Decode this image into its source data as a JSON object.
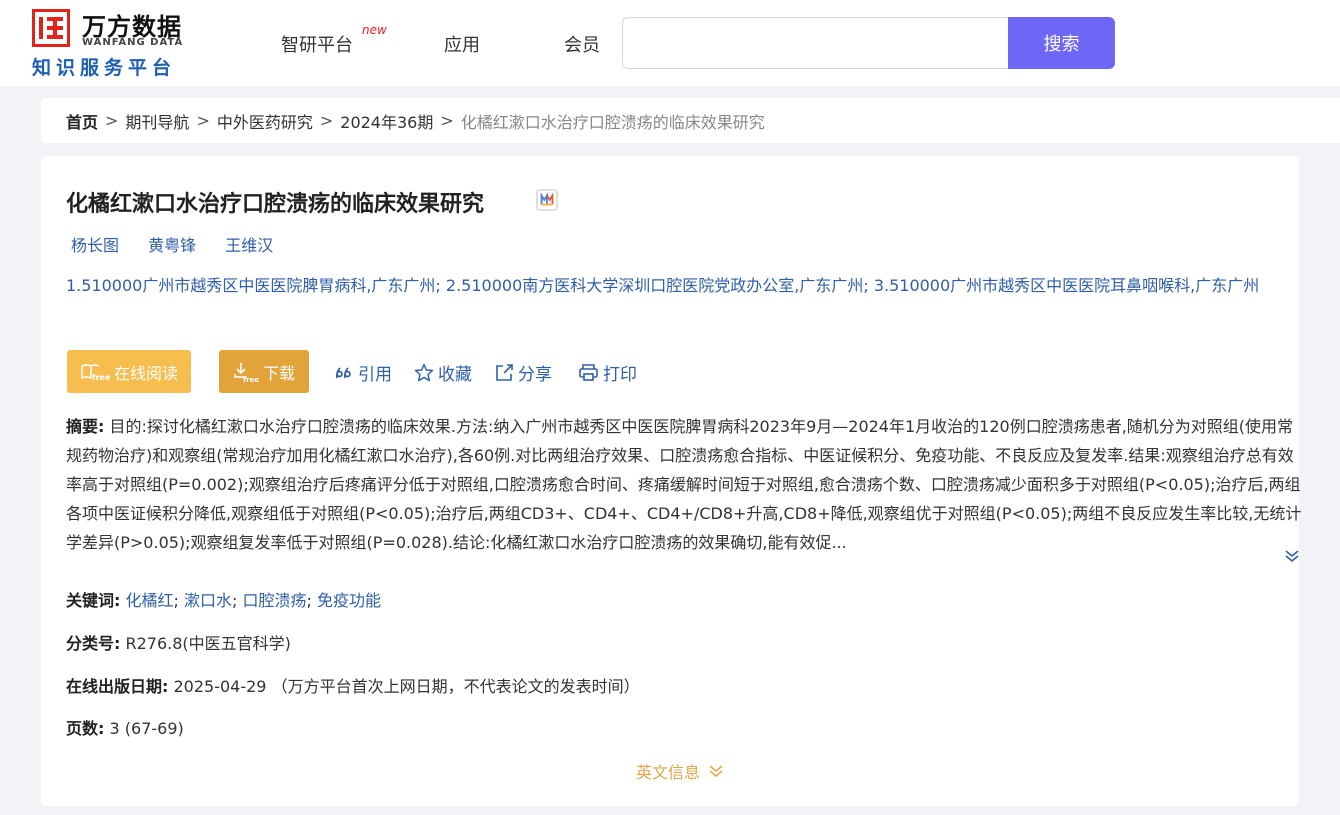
{
  "brand": {
    "name_cn": "万方数据",
    "name_en": "WANFANG DATA",
    "subtitle": "知识服务平台",
    "color": "#e2231a"
  },
  "nav": {
    "items": [
      "智研平台",
      "应用",
      "会员"
    ],
    "new_badge": "new"
  },
  "search": {
    "value": "",
    "placeholder": "",
    "button": "搜索",
    "button_color": "#6e67f5"
  },
  "breadcrumb": {
    "items": [
      "首页",
      "期刊导航",
      "中外医药研究",
      "2024年36期"
    ],
    "current": "化橘红漱口水治疗口腔溃疡的临床效果研究",
    "separator": ">"
  },
  "article": {
    "title": "化橘红漱口水治疗口腔溃疡的临床效果研究",
    "authors": [
      "杨长图",
      "黄粤锋",
      "王维汉"
    ],
    "affiliations": "1.510000广州市越秀区中医医院脾胃病科,广东广州; 2.510000南方医科大学深圳口腔医院党政办公室,广东广州; 3.510000广州市越秀区中医医院耳鼻咽喉科,广东广州",
    "actions": {
      "read": "在线阅读",
      "download": "下载",
      "cite": "引用",
      "collect": "收藏",
      "share": "分享",
      "print": "打印"
    },
    "abstract_label": "摘要:",
    "abstract": "目的:探讨化橘红漱口水治疗口腔溃疡的临床效果.方法:纳入广州市越秀区中医医院脾胃病科2023年9月—2024年1月收治的120例口腔溃疡患者,随机分为对照组(使用常规药物治疗)和观察组(常规治疗加用化橘红漱口水治疗),各60例.对比两组治疗效果、口腔溃疡愈合指标、中医证候积分、免疫功能、不良反应及复发率.结果:观察组治疗总有效率高于对照组(P=0.002);观察组治疗后疼痛评分低于对照组,口腔溃疡愈合时间、疼痛缓解时间短于对照组,愈合溃疡个数、口腔溃疡减少面积多于对照组(P<0.05);治疗后,两组各项中医证候积分降低,观察组低于对照组(P<0.05);治疗后,两组CD3+、CD4+、CD4+/CD8+升高,CD8+降低,观察组优于对照组(P<0.05);两组不良反应发生率比较,无统计学差异(P>0.05);观察组复发率低于对照组(P=0.028).结论:化橘红漱口水治疗口腔溃疡的效果确切,能有效促...",
    "keywords_label": "关键词:",
    "keywords": [
      "化橘红",
      "漱口水",
      "口腔溃疡",
      "免疫功能"
    ],
    "class_label": "分类号:",
    "class_value": "R276.8(中医五官科学)",
    "date_label": "在线出版日期:",
    "date_value": "2025-04-29",
    "date_note": "（万方平台首次上网日期，不代表论文的发表时间）",
    "pages_label": "页数:",
    "pages_value": "3 (67-69)",
    "english_info": "英文信息"
  }
}
